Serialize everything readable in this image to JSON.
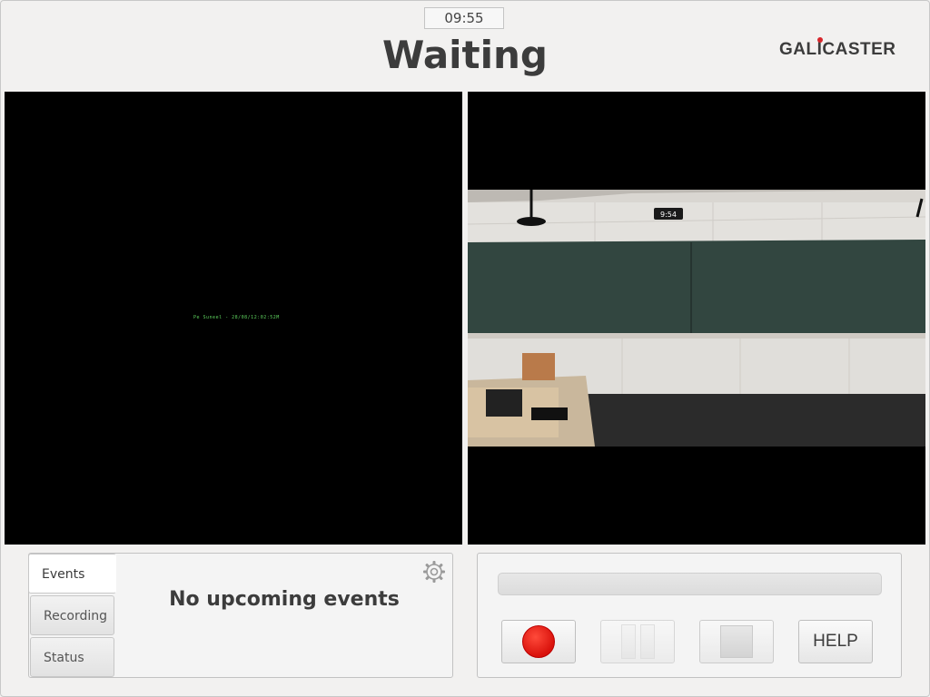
{
  "header": {
    "clock": "09:55",
    "status": "Waiting",
    "logo_pre": "GAL",
    "logo_i": "I",
    "logo_post": "CASTER"
  },
  "previews": {
    "left_overlay": "Pe Suneel - 28/08/12:02:52M",
    "right_clock": "9:54"
  },
  "events_panel": {
    "tabs": [
      {
        "label": "Events"
      },
      {
        "label": "Recording"
      },
      {
        "label": "Status"
      }
    ],
    "active_tab": "Events",
    "message": "No upcoming events"
  },
  "controls": {
    "progress": 0,
    "help_label": "HELP"
  },
  "colors": {
    "record": "#e0120c",
    "logo_dot": "#d7262b",
    "background": "#f2f1f0"
  },
  "icons": {
    "settings": "gear-icon",
    "record": "record-icon",
    "pause": "pause-icon",
    "stop": "stop-icon"
  }
}
